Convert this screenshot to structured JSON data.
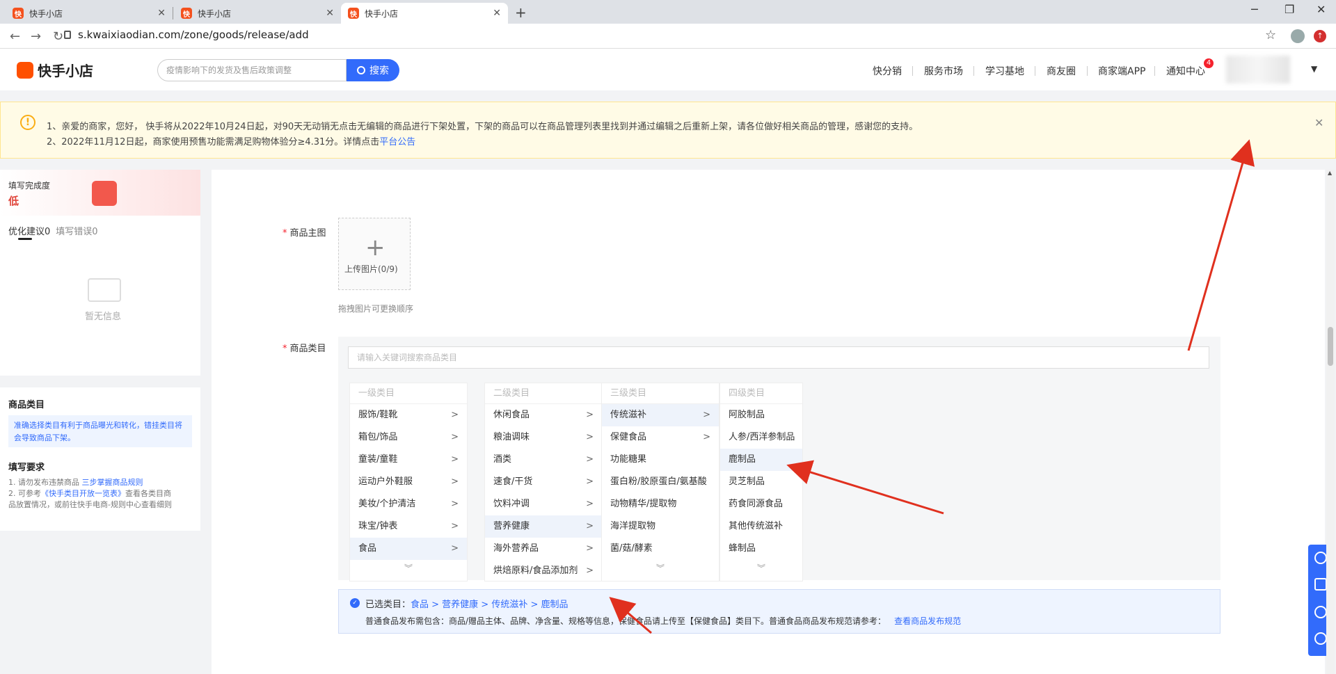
{
  "browser": {
    "tabs": [
      "快手小店",
      "快手小店",
      "快手小店"
    ],
    "url": "s.kwaixiaodian.com/zone/goods/release/add"
  },
  "header": {
    "logo": "快手小店",
    "search_placeholder": "疫情影响下的发货及售后政策调整",
    "search_button": "搜索",
    "nav": [
      "快分销",
      "服务市场",
      "学习基地",
      "商友圈",
      "商家端APP",
      "通知中心"
    ],
    "notify_count": "4"
  },
  "notice": {
    "line1": "1、亲爱的商家，您好， 快手将从2022年10月24日起，对90天无动销无点击无编辑的商品进行下架处置，下架的商品可以在商品管理列表里找到并通过编辑之后重新上架，请各位做好相关商品的管理，感谢您的支持。",
    "line2_prefix": "2、2022年11月12日起，商家使用预售功能需满足购物体验分≥4.31分。详情点击",
    "line2_link": "平台公告"
  },
  "sidebar": {
    "completeness_label": "填写完成度",
    "completeness_value": "低",
    "tab_suggest": "优化建议0",
    "tab_errors": "填写错误0",
    "empty_text": "暂无信息",
    "category_title": "商品类目",
    "category_tip": "准确选择类目有利于商品曝光和转化，错挂类目将会导致商品下架。",
    "req_title": "填写要求",
    "req1_prefix": "1. 请勿发布违禁商品 ",
    "req1_link": "三步掌握商品规则",
    "req2_prefix": "2. 可参考",
    "req2_link": "《快手类目开放一览表》",
    "req2_suffix": "查看各类目商",
    "req3": "品放置情况，或前往快手电商-规则中心查看细则"
  },
  "form": {
    "main_image_label": "商品主图",
    "upload_text": "上传图片(0/9)",
    "upload_hint": "拖拽图片可更换顺序",
    "category_label": "商品类目",
    "category_search_placeholder": "请输入关键词搜索商品类目",
    "columns": [
      {
        "header": "一级类目",
        "items": [
          "服饰/鞋靴",
          "箱包/饰品",
          "童装/童鞋",
          "运动户外鞋服",
          "美妆/个护清洁",
          "珠宝/钟表",
          "食品"
        ]
      },
      {
        "header": "二级类目",
        "items": [
          "休闲食品",
          "粮油调味",
          "酒类",
          "速食/干货",
          "饮料冲调",
          "营养健康",
          "海外营养品",
          "烘焙原料/食品添加剂"
        ]
      },
      {
        "header": "三级类目",
        "items": [
          "传统滋补",
          "保健食品",
          "功能糖果",
          "蛋白粉/胶原蛋白/氨基酸",
          "动物精华/提取物",
          "海洋提取物",
          "菌/菇/酵素"
        ]
      },
      {
        "header": "四级类目",
        "items": [
          "阿胶制品",
          "人参/西洋参制品",
          "鹿制品",
          "灵芝制品",
          "药食同源食品",
          "其他传统滋补",
          "蜂制品"
        ]
      }
    ],
    "selected_prefix": "已选类目：",
    "selected_path": "食品 > 营养健康 > 传统滋补 > 鹿制品",
    "selected_note": "普通食品发布需包含：商品/赠品主体、品牌、净含量、规格等信息，保健食品请上传至【保健食品】类目下。普通食品商品发布规范请参考：",
    "selected_note_link": "查看商品发布规范"
  }
}
